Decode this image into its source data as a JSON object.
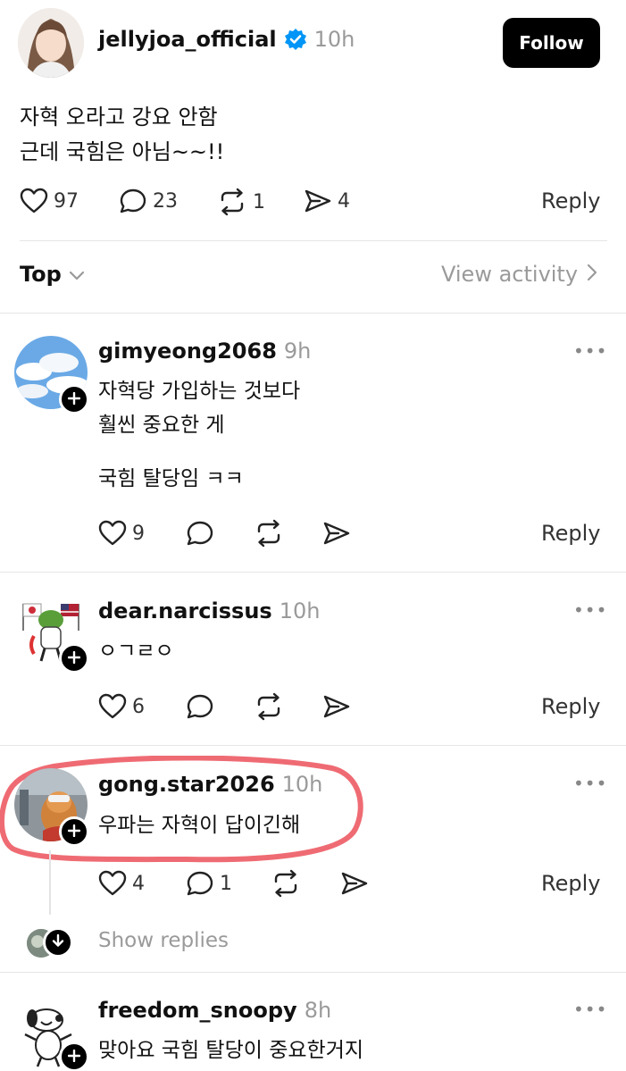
{
  "post": {
    "username": "jellyjoa_official",
    "time": "10h",
    "follow_label": "Follow",
    "lines": [
      "자혁 오라고 강요 안함",
      "근데 국힘은 아님~~!!"
    ],
    "likes": "97",
    "comments": "23",
    "reposts": "1",
    "shares": "4",
    "reply_label": "Reply"
  },
  "sort": {
    "label": "Top",
    "view_activity": "View activity"
  },
  "comments": [
    {
      "username": "gimyeong2068",
      "time": "9h",
      "lines": [
        "자혁당 가입하는 것보다",
        "훨씬 중요한 게",
        "",
        "국힘 탈당임 ㅋㅋ"
      ],
      "likes": "9",
      "replies": "",
      "reply_label": "Reply"
    },
    {
      "username": "dear.narcissus",
      "time": "10h",
      "lines": [
        "ㅇㄱㄹㅇ"
      ],
      "likes": "6",
      "replies": "",
      "reply_label": "Reply"
    },
    {
      "username": "gong.star2026",
      "time": "10h",
      "lines": [
        "우파는 자혁이 답이긴해"
      ],
      "likes": "4",
      "replies": "1",
      "reply_label": "Reply",
      "show_replies": "Show replies"
    },
    {
      "username": "freedom_snoopy",
      "time": "8h",
      "lines": [
        "맞아요 국힘 탈당이 중요한거지"
      ]
    }
  ],
  "colors": {
    "verified": "#0095f6",
    "highlight": "#ef6b73",
    "muted": "#9a9a9a"
  },
  "icons": [
    "heart-icon",
    "comment-icon",
    "repost-icon",
    "share-icon",
    "chevron-down-icon",
    "chevron-right-icon",
    "more-icon",
    "plus-icon",
    "verified-icon",
    "arrow-down-icon"
  ]
}
